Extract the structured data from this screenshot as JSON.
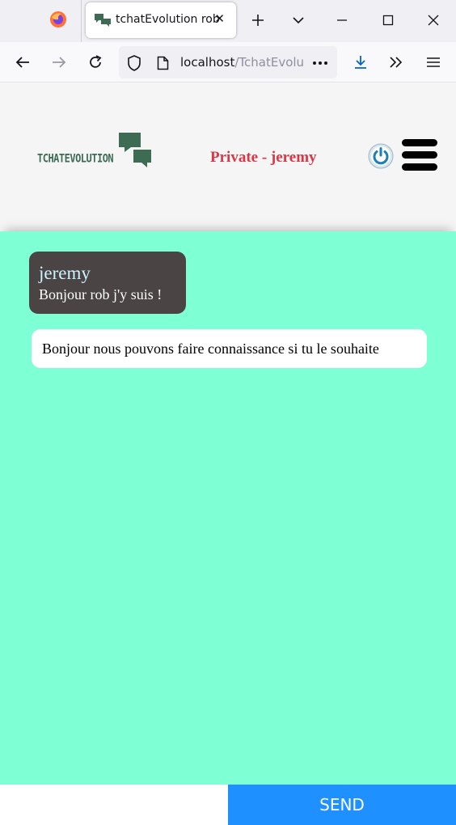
{
  "browser": {
    "tab_title": "tchatEvolution rob",
    "url_host": "localhost",
    "url_path": "/TchatEvolu"
  },
  "header": {
    "logo_text": "TCHATEVOLUTION",
    "private_label": "Private - jeremy"
  },
  "messages": [
    {
      "sender": "jeremy",
      "text": "Bonjour rob j'y suis !",
      "direction": "received"
    },
    {
      "sender": "",
      "text": "Bonjour nous pouvons faire connaissance si tu le souhaite",
      "direction": "sent"
    }
  ],
  "composer": {
    "input_value": "",
    "send_label": "SEND"
  },
  "colors": {
    "chat_background": "#7fffd4",
    "received_bubble": "#4a4444",
    "sent_bubble": "#ffffff",
    "private_label": "#dc3545",
    "send_button": "#1e90ff",
    "logo": "#3d6b54"
  }
}
